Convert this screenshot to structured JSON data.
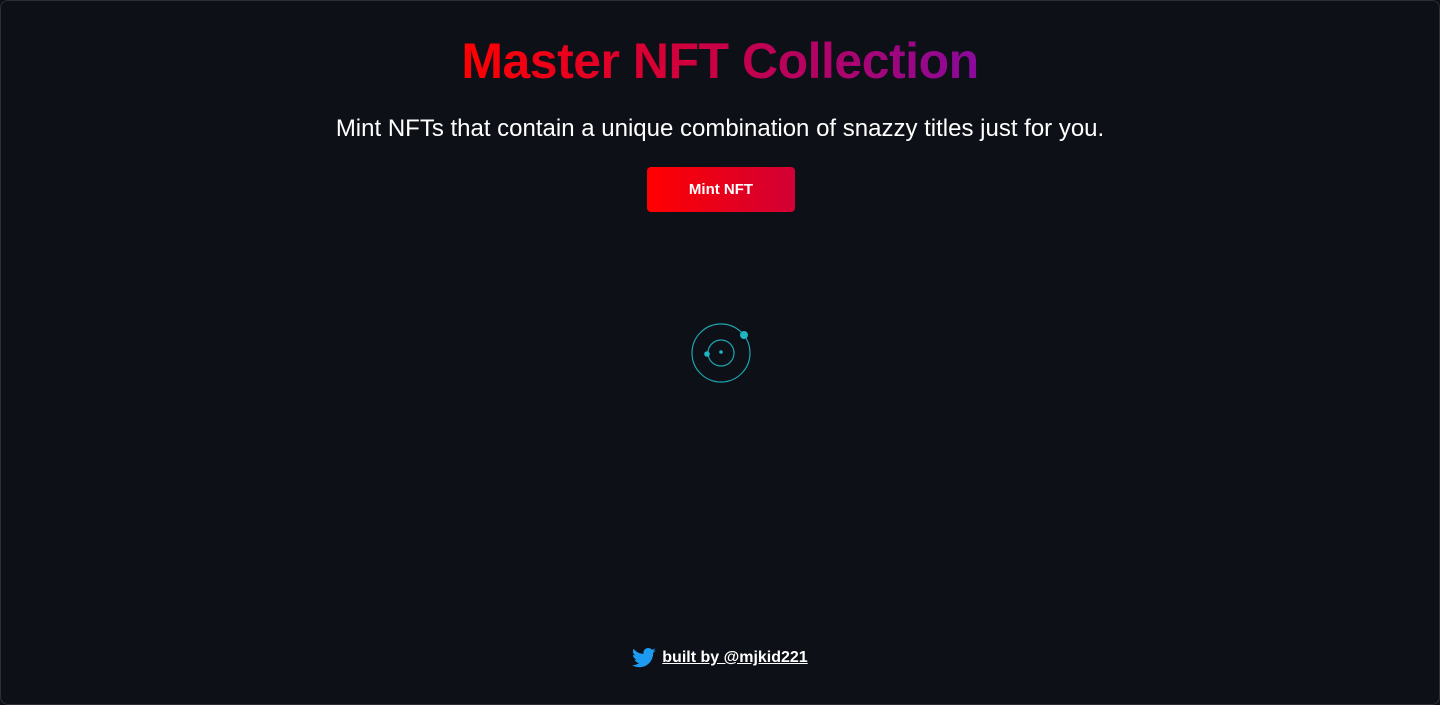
{
  "header": {
    "title": "Master NFT Collection",
    "subtitle": "Mint NFTs that contain a unique combination of snazzy titles just for you."
  },
  "actions": {
    "mint_label": "Mint NFT"
  },
  "loader": {
    "icon": "loading-spinner-icon",
    "color": "#1fb6c1"
  },
  "footer": {
    "icon": "twitter-icon",
    "link_label": "built by @mjkid221"
  },
  "colors": {
    "background": "#0d1016",
    "title_gradient": [
      "#ff0000",
      "#c3004e",
      "#8a0a9c"
    ],
    "button_gradient": [
      "#ff0000",
      "#d10035"
    ],
    "twitter_blue": "#1d9bf0"
  }
}
